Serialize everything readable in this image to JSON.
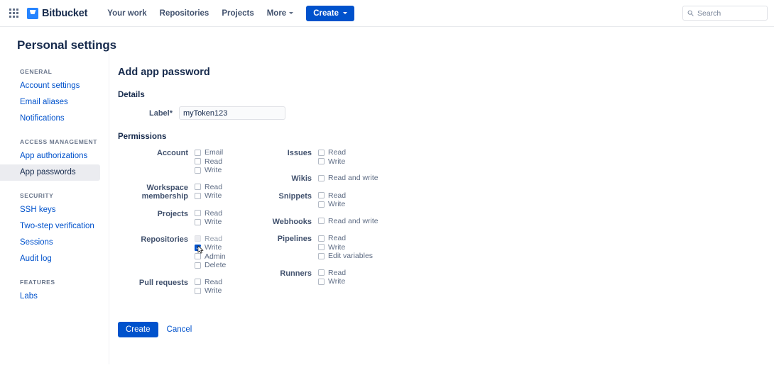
{
  "topnav": {
    "app_switcher_icon": "grid-apps-icon",
    "logo_icon": "bitbucket-logo-icon",
    "brand": "Bitbucket",
    "links": [
      {
        "label": "Your work",
        "has_caret": false
      },
      {
        "label": "Repositories",
        "has_caret": false
      },
      {
        "label": "Projects",
        "has_caret": false
      },
      {
        "label": "More",
        "has_caret": true
      }
    ],
    "create_label": "Create",
    "create_color": "#0052cc",
    "search": {
      "icon": "search-icon",
      "placeholder": "Search"
    }
  },
  "page_title": "Personal settings",
  "sidebar": {
    "groups": [
      {
        "heading": "GENERAL",
        "items": [
          {
            "label": "Account settings",
            "selected": false
          },
          {
            "label": "Email aliases",
            "selected": false
          },
          {
            "label": "Notifications",
            "selected": false
          }
        ]
      },
      {
        "heading": "ACCESS MANAGEMENT",
        "items": [
          {
            "label": "App authorizations",
            "selected": false
          },
          {
            "label": "App passwords",
            "selected": true
          }
        ]
      },
      {
        "heading": "SECURITY",
        "items": [
          {
            "label": "SSH keys",
            "selected": false
          },
          {
            "label": "Two-step verification",
            "selected": false
          },
          {
            "label": "Sessions",
            "selected": false
          },
          {
            "label": "Audit log",
            "selected": false
          }
        ]
      },
      {
        "heading": "FEATURES",
        "items": [
          {
            "label": "Labs",
            "selected": false
          }
        ]
      }
    ]
  },
  "main": {
    "form_title": "Add app password",
    "details": {
      "section_label": "Details",
      "label_field": {
        "label": "Label",
        "required_mark": "*",
        "value": "myToken123",
        "placeholder": ""
      }
    },
    "permissions": {
      "section_label": "Permissions",
      "left_column": [
        {
          "name": "Account",
          "options": [
            {
              "label": "Email",
              "checked": false,
              "disabled": false
            },
            {
              "label": "Read",
              "checked": false,
              "disabled": false
            },
            {
              "label": "Write",
              "checked": false,
              "disabled": false
            }
          ]
        },
        {
          "name": "Workspace membership",
          "options": [
            {
              "label": "Read",
              "checked": false,
              "disabled": false
            },
            {
              "label": "Write",
              "checked": false,
              "disabled": false
            }
          ]
        },
        {
          "name": "Projects",
          "options": [
            {
              "label": "Read",
              "checked": false,
              "disabled": false
            },
            {
              "label": "Write",
              "checked": false,
              "disabled": false
            }
          ]
        },
        {
          "name": "Repositories",
          "options": [
            {
              "label": "Read",
              "checked": false,
              "disabled": true
            },
            {
              "label": "Write",
              "checked": true,
              "disabled": false,
              "cursor": true
            },
            {
              "label": "Admin",
              "checked": false,
              "disabled": false
            },
            {
              "label": "Delete",
              "checked": false,
              "disabled": false
            }
          ]
        },
        {
          "name": "Pull requests",
          "options": [
            {
              "label": "Read",
              "checked": false,
              "disabled": false
            },
            {
              "label": "Write",
              "checked": false,
              "disabled": false
            }
          ]
        }
      ],
      "right_column": [
        {
          "name": "Issues",
          "options": [
            {
              "label": "Read",
              "checked": false,
              "disabled": false
            },
            {
              "label": "Write",
              "checked": false,
              "disabled": false
            }
          ]
        },
        {
          "name": "Wikis",
          "options": [
            {
              "label": "Read and write",
              "checked": false,
              "disabled": false
            }
          ]
        },
        {
          "name": "Snippets",
          "options": [
            {
              "label": "Read",
              "checked": false,
              "disabled": false
            },
            {
              "label": "Write",
              "checked": false,
              "disabled": false
            }
          ]
        },
        {
          "name": "Webhooks",
          "options": [
            {
              "label": "Read and write",
              "checked": false,
              "disabled": false
            }
          ]
        },
        {
          "name": "Pipelines",
          "options": [
            {
              "label": "Read",
              "checked": false,
              "disabled": false
            },
            {
              "label": "Write",
              "checked": false,
              "disabled": false
            },
            {
              "label": "Edit variables",
              "checked": false,
              "disabled": false
            }
          ]
        },
        {
          "name": "Runners",
          "options": [
            {
              "label": "Read",
              "checked": false,
              "disabled": false
            },
            {
              "label": "Write",
              "checked": false,
              "disabled": false
            }
          ]
        }
      ]
    },
    "actions": {
      "submit_label": "Create",
      "cancel_label": "Cancel"
    }
  }
}
